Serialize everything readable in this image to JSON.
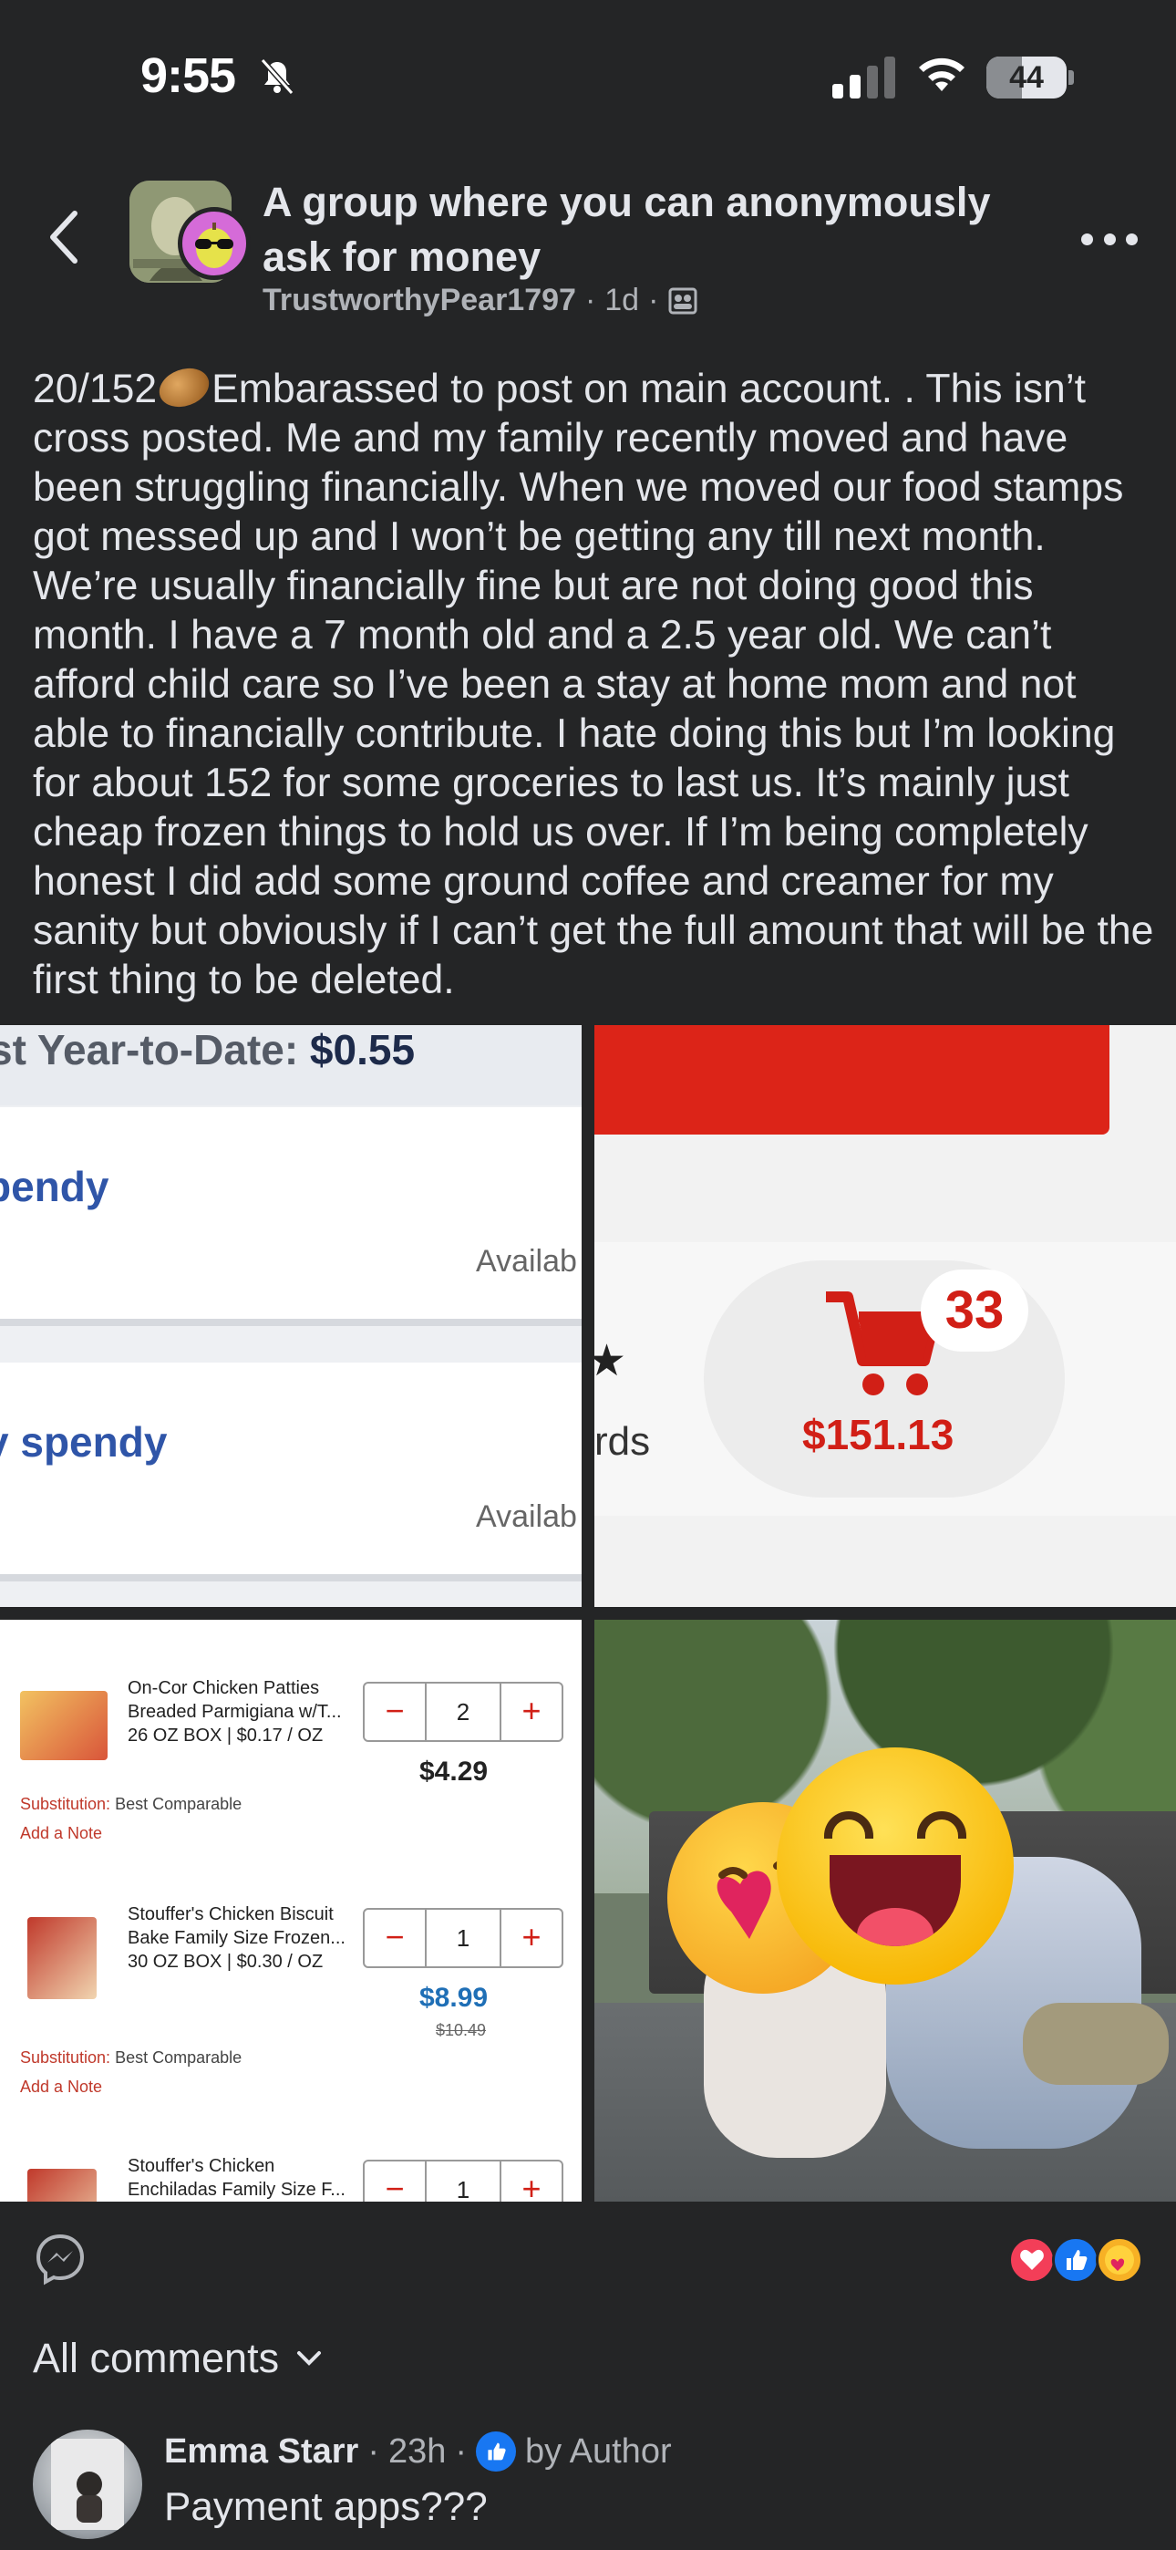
{
  "status_bar": {
    "time": "9:55",
    "battery": "44",
    "battery_level": 0.44
  },
  "header": {
    "group_name": "A group where you can anonymously ask for money",
    "author": "TrustworthyPear1797",
    "separator": "·",
    "age": "1d",
    "back_icon": "chevron-left-icon",
    "more_icon": "more-horizontal-icon"
  },
  "post": {
    "counter": "20/152",
    "body_text": "Embarassed to post on main account. . This isn’t cross posted. Me and my family recently moved and have been struggling financially. When we moved our food stamps got messed up and I won’t be getting any till next month. We’re usually financially fine but are not doing good this month. I have a 7 month old and a 2.5 year old. We can’t afford child care so I’ve been a stay at home mom and not able to financially contribute. I hate doing this but I’m looking for about 152 for some groceries to last us. It’s mainly just cheap frozen things to hold us over. If I’m being completely honest I did add some ground coffee and creamer for my sanity but obviously if I can’t get the full amount that will be the first thing to be deleted."
  },
  "photos": {
    "p1": {
      "ytd_label": "st Year-to-Date:",
      "ytd_value": "$0.55",
      "card1_title": "pendy",
      "card2_title": "y spendy",
      "avail": "Availab"
    },
    "p2": {
      "cart_count": "33",
      "cart_total": "$151.13",
      "partial_label": "rds"
    },
    "p3": {
      "items": [
        {
          "name": "On-Cor Chicken Patties Breaded Parmigiana w/T...",
          "size": "26 OZ BOX | $0.17 / OZ",
          "qty": "2",
          "price": "$4.29",
          "old_price": ""
        },
        {
          "name": "Stouffer's Chicken Biscuit Bake Family Size Frozen...",
          "size": "30 OZ BOX | $0.30 / OZ",
          "qty": "1",
          "price": "$8.99",
          "old_price": "$10.49"
        },
        {
          "name": "Stouffer's Chicken Enchiladas Family Size F...",
          "size": "",
          "qty": "1",
          "price": "",
          "old_price": ""
        }
      ],
      "substitution_label": "Substitution:",
      "substitution_value": "Best Comparable",
      "add_note": "Add a Note",
      "minus": "−",
      "plus": "+"
    }
  },
  "footer": {
    "all_comments": "All comments",
    "reactions": [
      "love-icon",
      "like-icon",
      "care-icon"
    ]
  },
  "comment": {
    "name": "Emma Starr",
    "age": "23h",
    "badge_label": "by Author",
    "text": "Payment apps???"
  },
  "colors": {
    "background": "#242526",
    "text": "#e4e6eb",
    "muted": "#b0b3b8",
    "facebook_blue": "#1877f2",
    "love_red": "#f33e58"
  }
}
